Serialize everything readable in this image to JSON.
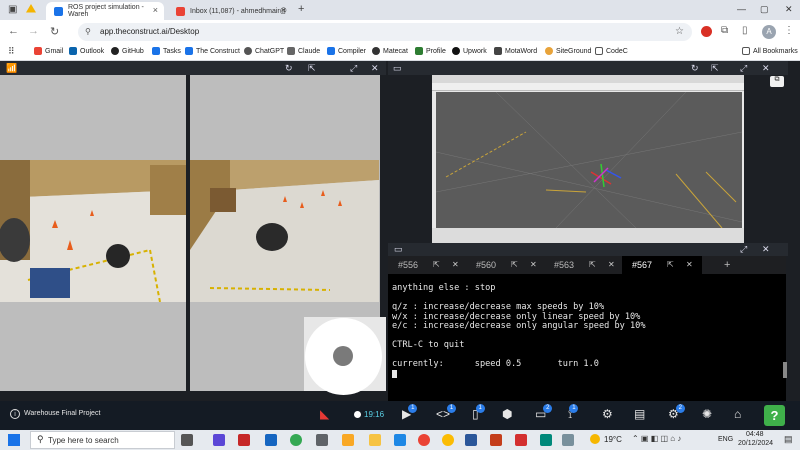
{
  "tabs": [
    {
      "title": "ROS project simulation - Wareh",
      "active": true
    },
    {
      "title": "Inbox (11,087) - ahmedhmair@",
      "active": false
    }
  ],
  "address": {
    "url": "app.theconstruct.ai/Desktop"
  },
  "bookmarks": [
    "Gmail",
    "Outlook",
    "GitHub",
    "Tasks",
    "The Construct",
    "ChatGPT",
    "Claude",
    "Compiler",
    "Matecat",
    "Profile",
    "Upwork",
    "MotaWord",
    "SiteGround",
    "CodeC"
  ],
  "all_bookmarks": "All Bookmarks",
  "terminal": {
    "tabs": [
      "#556",
      "#560",
      "#563",
      "#567"
    ],
    "lines": [
      "anything else : stop",
      "",
      "q/z : increase/decrease max speeds by 10%",
      "w/x : increase/decrease only linear speed by 10%",
      "e/c : increase/decrease only angular speed by 10%",
      "",
      "CTRL-C to quit",
      "",
      "currently:      speed 0.5       turn 1.0"
    ]
  },
  "toolbar": {
    "project_name": "Warehouse Final Project",
    "timer": "19:16",
    "badges": [
      "1",
      "1",
      "1",
      "2",
      "1",
      "2"
    ]
  },
  "taskbar": {
    "search_placeholder": "Type here to search",
    "weather": "19°C",
    "lang": "ENG",
    "time": "04:48",
    "date": "20/12/2024"
  },
  "colors": {
    "accent": "#1a73e8",
    "toolbar_bg": "#141b24",
    "help_green": "#3fb04a"
  }
}
